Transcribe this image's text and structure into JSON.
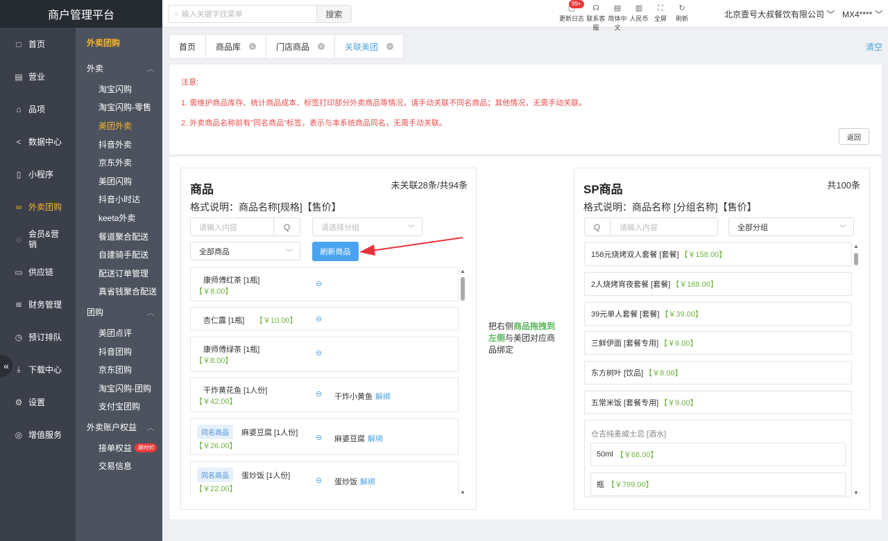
{
  "app": {
    "title": "商户管理平台"
  },
  "nav": {
    "items": [
      {
        "label": "首页",
        "icon": "□"
      },
      {
        "label": "营业",
        "icon": "▤"
      },
      {
        "label": "品项",
        "icon": "⌂"
      },
      {
        "label": "数据中心",
        "icon": "<"
      },
      {
        "label": "小程序",
        "icon": "▯"
      },
      {
        "label": "外卖团购",
        "icon": "∞"
      },
      {
        "label": "会员&营销",
        "icon": "◌"
      },
      {
        "label": "供应链",
        "icon": "▭"
      },
      {
        "label": "财务管理",
        "icon": "≋"
      },
      {
        "label": "预订排队",
        "icon": "◷"
      },
      {
        "label": "下载中心",
        "icon": "⤓"
      },
      {
        "label": "设置",
        "icon": "⚙"
      },
      {
        "label": "增值服务",
        "icon": "◎"
      }
    ],
    "collapse": "«"
  },
  "subnav": {
    "head": "外卖团购",
    "group1": "外卖",
    "g1": [
      "淘宝闪购",
      "淘宝闪购-零售",
      "美团外卖",
      "抖音外卖",
      "京东外卖",
      "美团闪购",
      "抖音小时达",
      "keeta外卖",
      "餐道聚合配送",
      "自建骑手配送",
      "配送订单管理",
      "真省钱聚合配送"
    ],
    "group2": "团购",
    "g2": [
      "美团点评",
      "抖音团购",
      "京东团购",
      "淘宝闪购-团购",
      "支付宝团购"
    ],
    "group3": "外卖账户权益",
    "g3a": "接单权益",
    "g3a_tag": "限时价",
    "g3b": "交易信息"
  },
  "topbar": {
    "search_placeholder": "输入关键字找菜单",
    "search_btn": "搜索",
    "tools": [
      {
        "label": "更新日志",
        "icon": "▢"
      },
      {
        "label": "联系客服",
        "icon": "☊"
      },
      {
        "label": "简体中文",
        "icon": "▤"
      },
      {
        "label": "人民币",
        "icon": "▥"
      },
      {
        "label": "全屏",
        "icon": "⛶"
      },
      {
        "label": "刷新",
        "icon": "↻"
      }
    ],
    "badge": "99+",
    "company": "北京壹号大叔餐饮有限公司 ﹀",
    "user": "MX4**** ﹀"
  },
  "tabs": [
    {
      "label": "首页",
      "close": ""
    },
    {
      "label": "商品库",
      "close": "×"
    },
    {
      "label": "门店商品",
      "close": "×"
    },
    {
      "label": "关联美团",
      "close": "×"
    }
  ],
  "clear": "清空",
  "notice": {
    "title": "注意:",
    "line1": "1. 需维护商品库存、统计商品成本、标签打印部分外卖商品等情况，请手动关联不同名商品；其他情况，无需手动关联。",
    "line2": "2. 外卖商品名称前有\"同名商品\"标签，表示与本系统商品同名，无需手动关联。",
    "back": "返回"
  },
  "left": {
    "title": "商品",
    "summary": "未关联28条/共94条",
    "format": "格式说明：商品名称[规格]【售价】",
    "search_placeholder": "请输入内容",
    "group_placeholder": "请选择分组",
    "filter": "全部商品",
    "refresh": "刷新商品",
    "rows": [
      {
        "tag": "",
        "name": "康师傅红茶 [1瓶]",
        "price": "【￥8.00】",
        "bound": "",
        "unbind": "",
        "inline": false
      },
      {
        "tag": "",
        "name": "杏仁露 [1瓶]",
        "price": "【￥10.00】",
        "bound": "",
        "unbind": "",
        "inline": true
      },
      {
        "tag": "",
        "name": "康师傅绿茶 [1瓶]",
        "price": "【￥8.00】",
        "bound": "",
        "unbind": "",
        "inline": false
      },
      {
        "tag": "",
        "name": "干炸黄花鱼 [1人份]",
        "price": "【￥42.00】",
        "bound": "干炸小黄鱼",
        "unbind": "解绑",
        "inline": false
      },
      {
        "tag": "同名商品",
        "name": "麻婆豆腐 [1人份]",
        "price": "【￥26.00】",
        "bound": "麻婆豆腐",
        "unbind": "解绑",
        "inline": false
      },
      {
        "tag": "同名商品",
        "name": "蛋炒饭 [1人份]",
        "price": "【￥22.00】",
        "bound": "蛋炒饭",
        "unbind": "解绑",
        "inline": false
      }
    ]
  },
  "hint": {
    "a": "把右侧",
    "b": "商品拖拽到左侧",
    "c": "与美团对应商品绑定"
  },
  "right": {
    "title": "SP商品",
    "summary": "共100条",
    "format": "格式说明：商品名称 [分组名称]【售价】",
    "search_placeholder": "请输入内容",
    "group": "全部分组",
    "rows": [
      {
        "name": "158元烧烤双人套餐 [套餐]",
        "price": "【￥158.00】"
      },
      {
        "name": "2人烧烤宵夜套餐 [套餐]",
        "price": "【￥168.00】"
      },
      {
        "name": "39元单人套餐 [套餐]",
        "price": "【￥39.00】"
      },
      {
        "name": "三鲜伊面 [套餐专用]",
        "price": "【￥6.00】"
      },
      {
        "name": "东方树叶 [饮品]",
        "price": "【￥8.00】"
      },
      {
        "name": "五常米饭 [套餐专用]",
        "price": "【￥9.00】"
      }
    ],
    "group_item": {
      "title": "仓吉纯麦威士忌 [酒水]",
      "specs": [
        {
          "name": "50ml",
          "price": "【￥68.00】"
        },
        {
          "name": "瓶",
          "price": "【￥799.00】"
        }
      ]
    }
  },
  "colors": {
    "accent": "#4aa3f0",
    "price": "#6db33f",
    "warn": "#e84d4d",
    "menu_active": "#f7b52c",
    "arrow": "#e8323a"
  }
}
